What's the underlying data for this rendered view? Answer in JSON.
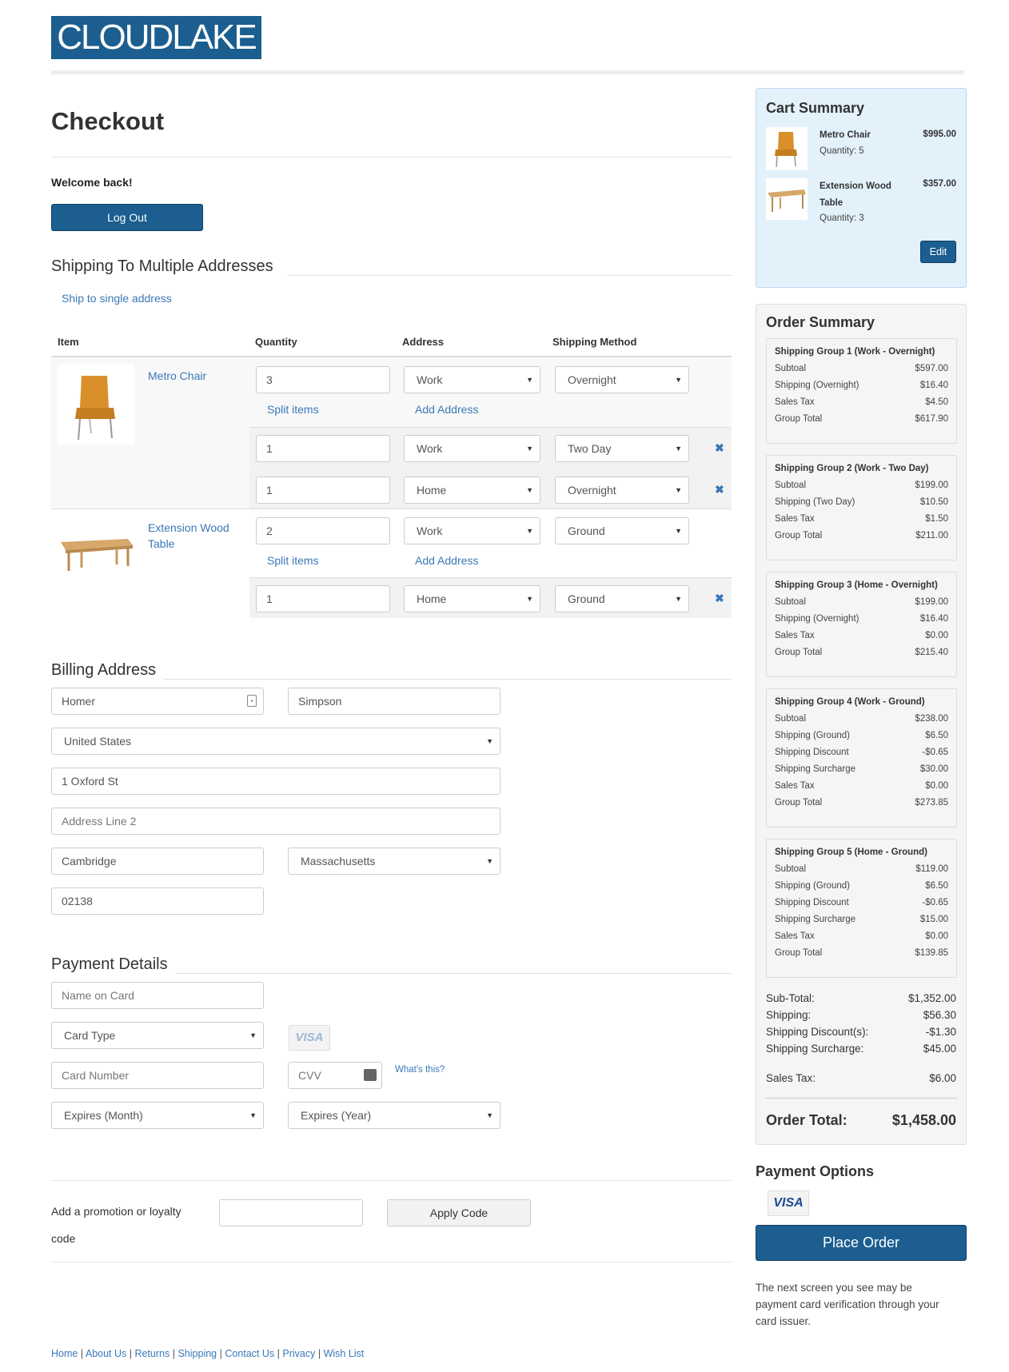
{
  "brand": {
    "logo_text": "CLOUDLAKE"
  },
  "checkout": {
    "title": "Checkout",
    "welcome": "Welcome back!",
    "logout_label": "Log Out"
  },
  "shipping": {
    "section_title": "Shipping To Multiple Addresses",
    "single_address_link": "Ship to single address",
    "columns": [
      "Item",
      "Quantity",
      "Address",
      "Shipping Method"
    ],
    "split_label": "Split items",
    "add_address_label": "Add Address",
    "items": [
      {
        "name": "Metro Chair",
        "rows": [
          {
            "qty": "3",
            "address": "Work",
            "method": "Overnight"
          },
          {
            "qty": "1",
            "address": "Work",
            "method": "Two Day"
          },
          {
            "qty": "1",
            "address": "Home",
            "method": "Overnight"
          }
        ]
      },
      {
        "name_line1": "Extension Wood",
        "name_line2": "Table",
        "rows": [
          {
            "qty": "2",
            "address": "Work",
            "method": "Ground"
          },
          {
            "qty": "1",
            "address": "Home",
            "method": "Ground"
          }
        ]
      }
    ]
  },
  "billing": {
    "section_title": "Billing Address",
    "first_name": "Homer",
    "last_name": "Simpson",
    "country": "United States",
    "address1": "1 Oxford St",
    "address2_placeholder": "Address Line 2",
    "city": "Cambridge",
    "state": "Massachusetts",
    "zip": "02138"
  },
  "payment": {
    "section_title": "Payment Details",
    "name_placeholder": "Name on Card",
    "card_type": "Card Type",
    "card_badge": "VISA",
    "card_number_placeholder": "Card Number",
    "cvv_placeholder": "CVV",
    "whats_this": "What's this?",
    "exp_month": "Expires (Month)",
    "exp_year": "Expires (Year)"
  },
  "promo": {
    "label_line1": "Add a promotion or loyalty",
    "label_line2": "code",
    "apply_label": "Apply Code"
  },
  "cart_summary": {
    "title": "Cart Summary",
    "items": [
      {
        "name": "Metro Chair",
        "qty": "Quantity: 5",
        "price": "$995.00"
      },
      {
        "name_line1": "Extension Wood",
        "name_line2": "Table",
        "qty": "Quantity: 3",
        "price": "$357.00"
      }
    ],
    "edit_label": "Edit"
  },
  "order_summary": {
    "title": "Order Summary",
    "groups": [
      {
        "title": "Shipping Group 1 (Work - Overnight)",
        "lines": [
          [
            "Subtoal",
            "$597.00"
          ],
          [
            "Shipping (Overnight)",
            "$16.40"
          ],
          [
            "Sales Tax",
            "$4.50"
          ],
          [
            "Group Total",
            "$617.90"
          ]
        ]
      },
      {
        "title": "Shipping Group 2 (Work - Two Day)",
        "lines": [
          [
            "Subtoal",
            "$199.00"
          ],
          [
            "Shipping (Two Day)",
            "$10.50"
          ],
          [
            "Sales Tax",
            "$1.50"
          ],
          [
            "Group Total",
            "$211.00"
          ]
        ]
      },
      {
        "title": "Shipping Group 3 (Home - Overnight)",
        "lines": [
          [
            "Subtoal",
            "$199.00"
          ],
          [
            "Shipping (Overnight)",
            "$16.40"
          ],
          [
            "Sales Tax",
            "$0.00"
          ],
          [
            "Group Total",
            "$215.40"
          ]
        ]
      },
      {
        "title": "Shipping Group 4 (Work - Ground)",
        "lines": [
          [
            "Subtoal",
            "$238.00"
          ],
          [
            "Shipping (Ground)",
            "$6.50"
          ],
          [
            "Shipping Discount",
            "-$0.65"
          ],
          [
            "Shipping Surcharge",
            "$30.00"
          ],
          [
            "Sales Tax",
            "$0.00"
          ],
          [
            "Group Total",
            "$273.85"
          ]
        ]
      },
      {
        "title": "Shipping Group 5 (Home - Ground)",
        "lines": [
          [
            "Subtoal",
            "$119.00"
          ],
          [
            "Shipping (Ground)",
            "$6.50"
          ],
          [
            "Shipping Discount",
            "-$0.65"
          ],
          [
            "Shipping Surcharge",
            "$15.00"
          ],
          [
            "Sales Tax",
            "$0.00"
          ],
          [
            "Group Total",
            "$139.85"
          ]
        ]
      }
    ],
    "totals": [
      [
        "Sub-Total:",
        "$1,352.00"
      ],
      [
        "Shipping:",
        "$56.30"
      ],
      [
        "Shipping Discount(s):",
        "-$1.30"
      ],
      [
        "Shipping Surcharge:",
        "$45.00"
      ]
    ],
    "sales_tax": [
      "Sales Tax:",
      "$6.00"
    ],
    "order_total": [
      "Order Total:",
      "$1,458.00"
    ]
  },
  "payment_options": {
    "title": "Payment Options",
    "badge": "VISA",
    "place_order_label": "Place Order",
    "note_line1": "The next screen you see may be",
    "note_line2": "payment card verification through your",
    "note_line3": "card issuer."
  },
  "footer": {
    "links": [
      "Home",
      "About Us",
      "Returns",
      "Shipping",
      "Contact Us",
      "Privacy",
      "Wish List"
    ]
  },
  "colors": {
    "brand": "#1b5e8f",
    "link": "#3a78b8",
    "cart_bg": "#e3f1fb"
  }
}
